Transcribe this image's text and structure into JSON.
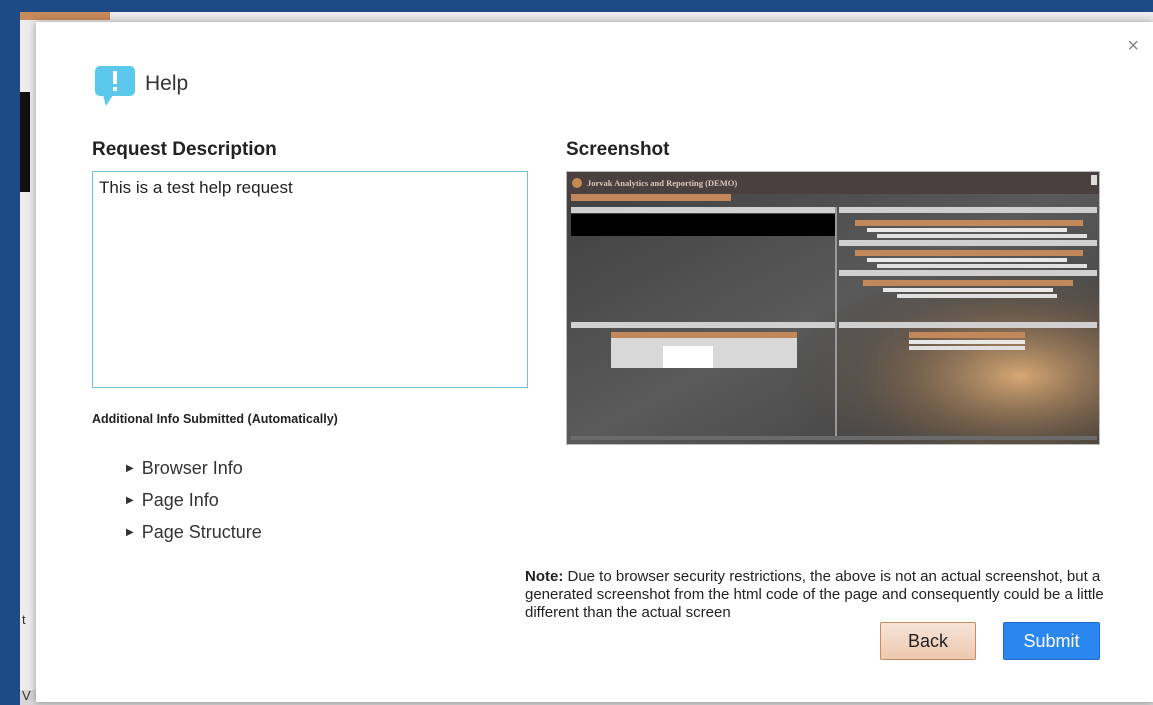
{
  "dialog": {
    "title": "Help",
    "close_glyph": "×"
  },
  "request": {
    "heading": "Request Description",
    "text": "This is a test help request"
  },
  "additional": {
    "heading": "Additional Info Submitted (Automatically)",
    "items": [
      "Browser Info",
      "Page Info",
      "Page Structure"
    ]
  },
  "screenshot": {
    "heading": "Screenshot",
    "app_title": "Jorvak Analytics and Reporting (DEMO)"
  },
  "note": {
    "label": "Note:",
    "text": " Due to browser security restrictions, the above is not an actual screenshot, but a generated screenshot from the html code of the page and consequently could be a little different than the actual screen"
  },
  "buttons": {
    "back": "Back",
    "submit": "Submit"
  },
  "background": {
    "side_labels": [
      "t",
      "V"
    ]
  },
  "colors": {
    "accent_blue": "#2b86f0",
    "back_button": "#eec8ae",
    "textarea_border": "#6cc3d8",
    "help_icon": "#5bc8ec",
    "page_background": "#1e4a86"
  },
  "icons": {
    "help": "help-speech-bubble-icon",
    "close": "close-icon",
    "expand": "triangle-right-icon"
  }
}
